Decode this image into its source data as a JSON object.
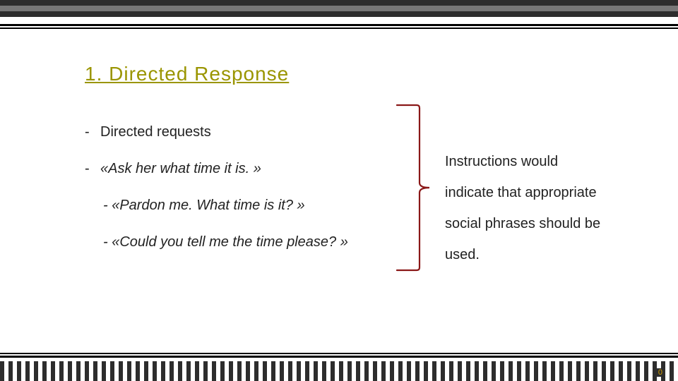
{
  "heading": "1. Directed Response",
  "bullets": {
    "item1": "Directed requests",
    "item2": "«Ask her what time it is. »",
    "item3": "- «Pardon me. What time is it? »",
    "item4": "- «Could you tell me the time please? »"
  },
  "explain": "Instructions would indicate that appropriate social phrases should be used.",
  "pageNumber": "0",
  "colors": {
    "accent": "#9a9500",
    "bracket": "#8a1818"
  }
}
